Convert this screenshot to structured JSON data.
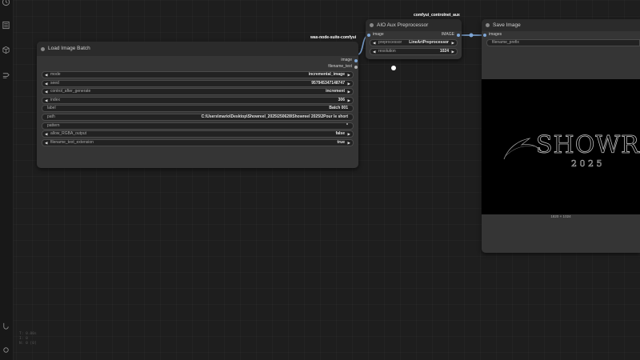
{
  "toolbar": {
    "icons": [
      "history-icon",
      "queue-icon",
      "cube-icon",
      "workflow-icon",
      "link-icon"
    ]
  },
  "stats": {
    "lines": [
      "T: 0.00s",
      "I: 0",
      "N: 0 [0]"
    ]
  },
  "nodes": {
    "load_image_batch": {
      "pack": "was-node-suite-comfyui",
      "title": "Load Image Batch",
      "outputs": [
        "image",
        "filename_text"
      ],
      "widgets": [
        {
          "name": "mode",
          "value": "incremental_image",
          "arrows": true
        },
        {
          "name": "seed",
          "value": "957945347148747",
          "arrows": true
        },
        {
          "name": "control_after_generate",
          "value": "increment",
          "arrows": true
        },
        {
          "name": "index",
          "value": "306",
          "arrows": true
        },
        {
          "name": "label",
          "value": "Batch 001",
          "arrows": false
        },
        {
          "name": "path",
          "value": "C:\\Users\\mario\\Desktop\\Showreel_2025\\250628\\Showreel 2025\\2Pour le short",
          "arrows": false
        },
        {
          "name": "pattern",
          "value": "*",
          "arrows": false
        },
        {
          "name": "allow_RGBA_output",
          "value": "false",
          "arrows": true
        },
        {
          "name": "filename_text_extension",
          "value": "true",
          "arrows": true
        }
      ]
    },
    "aio_aux": {
      "pack": "comfyui_controlnet_aux",
      "title": "AIO Aux Preprocessor",
      "input": "image",
      "output": "IMAGE",
      "widgets": [
        {
          "name": "preprocessor",
          "value": "LineArtPreprocessor",
          "arrows": true
        },
        {
          "name": "resolution",
          "value": "1024",
          "arrows": true
        }
      ]
    },
    "save_image": {
      "title": "Save Image",
      "input": "images",
      "widgets": [
        {
          "name": "filename_prefix",
          "value": "",
          "arrows": false
        }
      ],
      "preview": {
        "text": "SHOWRE",
        "year": "2 0 2 5",
        "size_label": "1820 × 1024"
      }
    }
  },
  "colors": {
    "image_link": "#7ea6d6",
    "image_slot": "#7ea6d6",
    "string_slot": "#b0b0b0"
  }
}
